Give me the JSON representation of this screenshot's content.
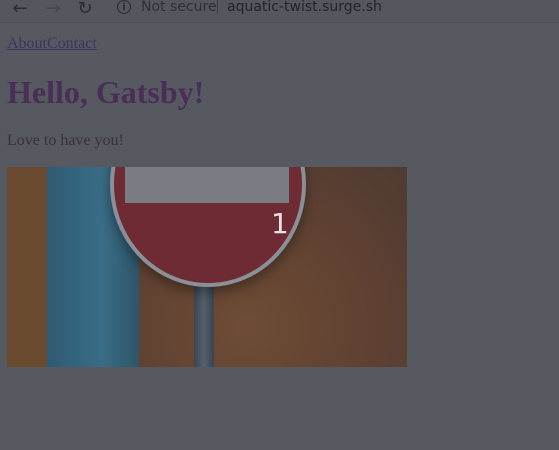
{
  "browser": {
    "back_icon": "arrow-left-icon",
    "forward_icon": "arrow-right-icon",
    "reload_icon": "reload-icon",
    "info_icon": "info-icon",
    "security_label": "Not secure",
    "url": "aquatic-twist.surge.sh"
  },
  "nav": {
    "about_label": "About",
    "contact_label": "Contact"
  },
  "main": {
    "heading": "Hello, Gatsby!",
    "subtitle": "Love to have you!",
    "hero_number": "1"
  },
  "colors": {
    "overlay": "#575961",
    "link": "#3a3464",
    "heading": "#4a2e58",
    "cursor": "#b0121c"
  }
}
